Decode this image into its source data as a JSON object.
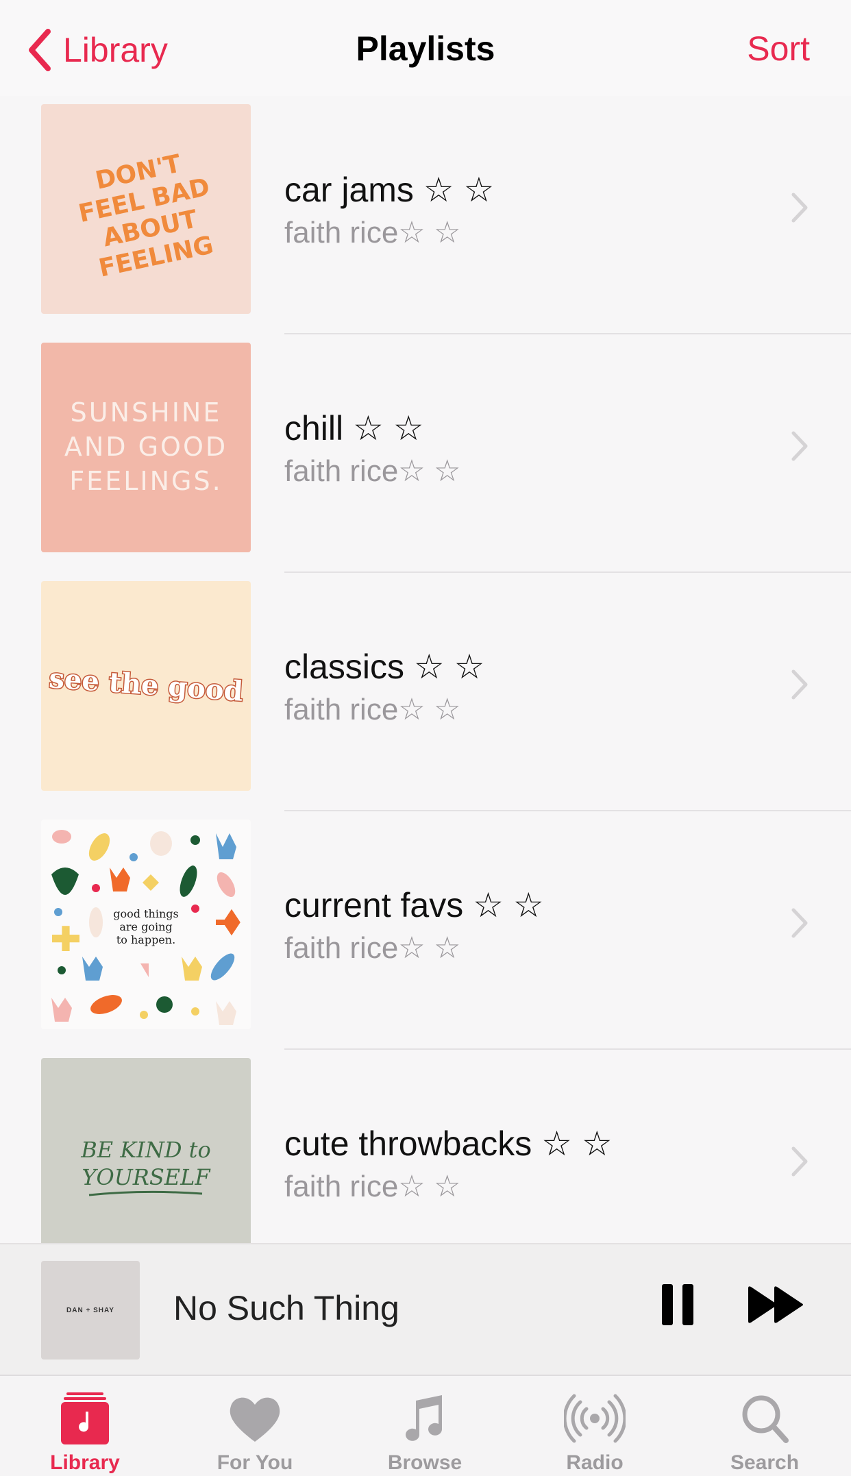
{
  "nav": {
    "back_label": "Library",
    "title": "Playlists",
    "sort_label": "Sort"
  },
  "playlists": [
    {
      "title": "car jams ☆ ☆",
      "subtitle": "faith rice☆ ☆",
      "art_text": [
        "DON'T",
        "FEEL BAD",
        "ABOUT",
        "FEELING"
      ]
    },
    {
      "title": "chill ☆ ☆",
      "subtitle": "faith rice☆ ☆",
      "art_text": [
        "SUNSHINE",
        "AND GOOD",
        "FEELINGS."
      ]
    },
    {
      "title": "classics ☆ ☆",
      "subtitle": "faith rice☆ ☆",
      "art_text": [
        "see the good"
      ]
    },
    {
      "title": "current favs ☆ ☆",
      "subtitle": "faith rice☆ ☆",
      "art_text": [
        "good things",
        "are going",
        "to happen."
      ]
    },
    {
      "title": "cute throwbacks ☆ ☆",
      "subtitle": "faith rice☆ ☆",
      "art_text": [
        "BE KIND to",
        "YOURSELF"
      ]
    }
  ],
  "now_playing": {
    "art_text": "DAN + SHAY",
    "title": "No Such Thing"
  },
  "tabs": [
    {
      "label": "Library",
      "icon": "library-icon",
      "active": true
    },
    {
      "label": "For You",
      "icon": "heart-icon",
      "active": false
    },
    {
      "label": "Browse",
      "icon": "music-note-icon",
      "active": false
    },
    {
      "label": "Radio",
      "icon": "radio-icon",
      "active": false
    },
    {
      "label": "Search",
      "icon": "search-icon",
      "active": false
    }
  ],
  "colors": {
    "accent": "#e8294f",
    "secondary_text": "#9a979b",
    "inactive_tab": "#9d9b9e"
  }
}
